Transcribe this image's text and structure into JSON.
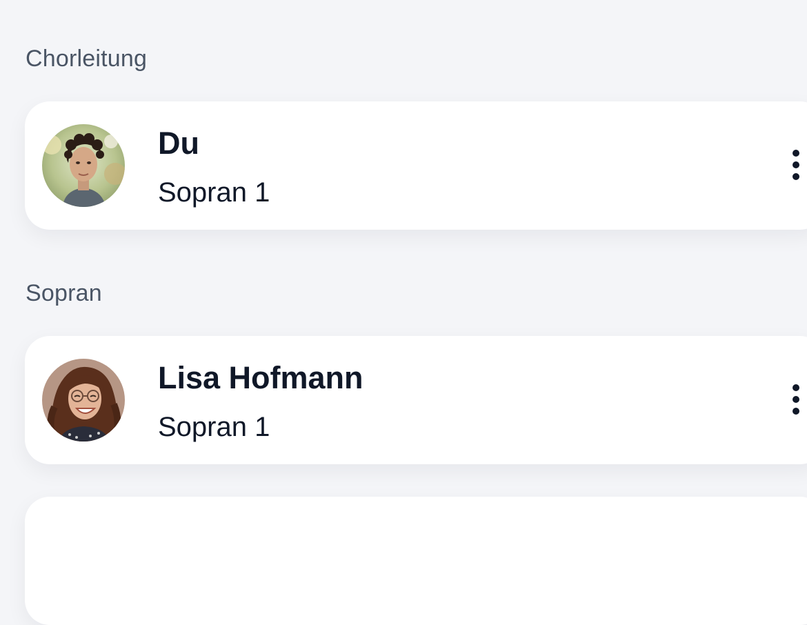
{
  "sections": [
    {
      "label": "Chorleitung",
      "members": [
        {
          "name": "Du",
          "role": "Sopran 1",
          "avatar_icon": "avatar-photo-curly-short-hair"
        }
      ]
    },
    {
      "label": "Sopran",
      "members": [
        {
          "name": "Lisa Hofmann",
          "role": "Sopran 1",
          "avatar_icon": "avatar-photo-long-curly-hair-glasses"
        }
      ]
    }
  ],
  "more_icon": "more-vertical-icon",
  "colors": {
    "background": "#f4f5f8",
    "card": "#ffffff",
    "text_primary": "#101828",
    "section_label": "#4a5565"
  }
}
